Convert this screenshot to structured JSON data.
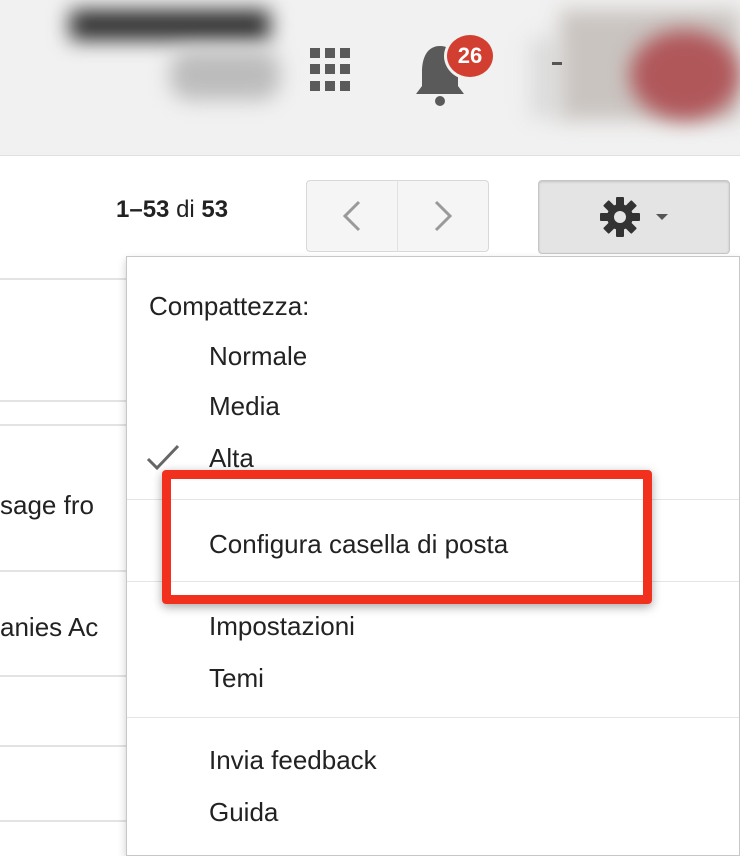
{
  "header": {
    "notification_count": "26",
    "icons": [
      "apps-grid-icon",
      "notifications-bell-icon",
      "avatar"
    ]
  },
  "toolbar": {
    "pager": {
      "start_end": "1–53",
      "of_label": "di",
      "total": "53"
    },
    "prev_icon": "chevron-left-icon",
    "next_icon": "chevron-right-icon",
    "settings_icon": "gear-icon"
  },
  "list": {
    "row_snippets": [
      "sage fro",
      "anies Ac"
    ]
  },
  "settings_menu": {
    "density_heading": "Compattezza:",
    "density_options": [
      {
        "label": "Normale",
        "checked": false
      },
      {
        "label": "Media",
        "checked": false
      },
      {
        "label": "Alta",
        "checked": true
      }
    ],
    "configure_inbox": "Configura casella di posta",
    "settings": "Impostazioni",
    "themes": "Temi",
    "send_feedback": "Invia feedback",
    "help": "Guida"
  },
  "colors": {
    "highlight": "#f2301e",
    "badge": "#d23f31"
  }
}
